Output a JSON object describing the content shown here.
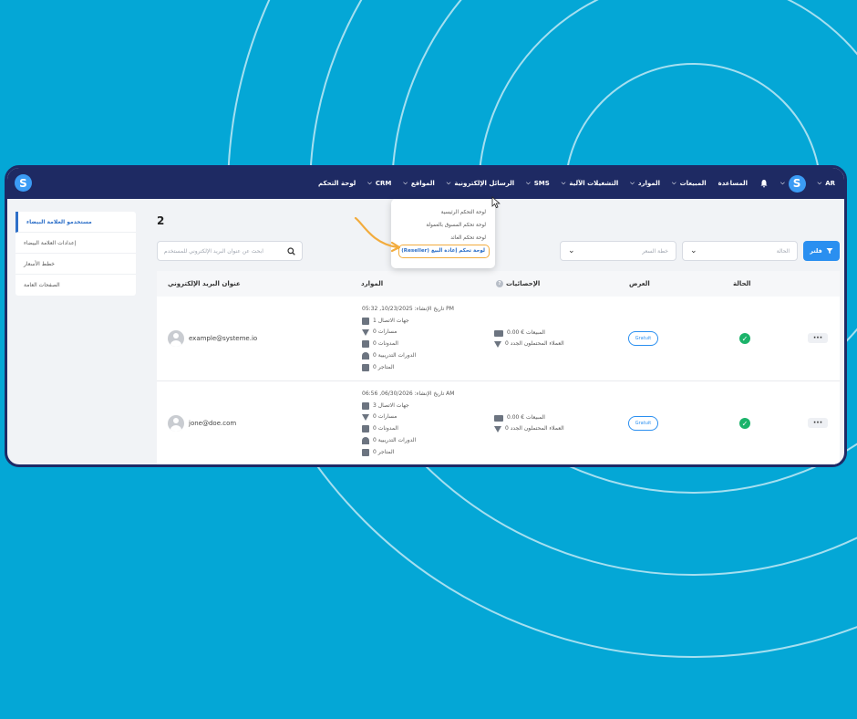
{
  "topbar": {
    "lang": "AR",
    "nav": [
      {
        "label": "لوحة التحكم",
        "caret": false
      },
      {
        "label": "CRM",
        "caret": true
      },
      {
        "label": "المواقع",
        "caret": true
      },
      {
        "label": "الرسائل الإلكترونية",
        "caret": true
      },
      {
        "label": "SMS",
        "caret": true
      },
      {
        "label": "التشغيلات الآلية",
        "caret": true
      },
      {
        "label": "الموارد",
        "caret": true
      },
      {
        "label": "المبيعات",
        "caret": true
      },
      {
        "label": "المساعدة",
        "caret": false
      }
    ],
    "avatar_letter": "S",
    "logo_letter": "S"
  },
  "sidebar": {
    "items": [
      {
        "label": "مستخدمو العلامة البيضاء",
        "active": true
      },
      {
        "label": "إعدادات العلامة البيضاء",
        "active": false
      },
      {
        "label": "خطط الأسعار",
        "active": false
      },
      {
        "label": "الصفحات العامة",
        "active": false
      }
    ]
  },
  "main": {
    "count": "2",
    "search_placeholder": "ابحث عن عنوان البريد الإلكتروني للمستخدم",
    "price_plan_placeholder": "خطة السعر",
    "status_placeholder": "الحالة",
    "filter_label": "فلتر"
  },
  "table": {
    "headers": {
      "email": "عنوان البريد الإلكتروني",
      "resources": "الموارد",
      "stats": "الإحصائيات",
      "offer": "العرض",
      "status": "الحالة"
    },
    "rows": [
      {
        "email": "example@systeme.io",
        "created": "تاريخ الإنشاء: 10/23/2025, 05:32 PM",
        "contacts": "جهات الاتصال 1",
        "funnels": "مسارات 0",
        "blogs": "المدونات 0",
        "courses": "الدورات التدريبية 0",
        "stores": "المتاجر 0",
        "sales": "المبيعات € 0.00",
        "leads": "العملاء المحتملون الجدد 0",
        "offer": "Gratuit"
      },
      {
        "email": "jone@doe.com",
        "created": "تاريخ الإنشاء: 06/30/2026, 06:56 AM",
        "contacts": "جهات الاتصال 3",
        "funnels": "مسارات 0",
        "blogs": "المدونات 0",
        "courses": "الدورات التدريبية 0",
        "stores": "المتاجر 0",
        "sales": "المبيعات € 0.00",
        "leads": "العملاء المحتملون الجدد 0",
        "offer": "Gratuit"
      }
    ]
  },
  "dropdown": {
    "items": [
      {
        "label": "لوحة التحكم الرئيسية",
        "highlight": false
      },
      {
        "label": "لوحة تحكم المسوق بالعمولة",
        "highlight": false
      },
      {
        "label": "لوحة تحكم العائد",
        "highlight": false
      },
      {
        "label": "(Reseller) لوحة تحكم إعادة البيع",
        "highlight": true
      }
    ]
  },
  "colors": {
    "background": "#04a7d6",
    "topbar": "#1e2a63",
    "accent": "#2a8ff0",
    "highlight": "#f2ac3e",
    "status_ok": "#1bb36a"
  },
  "icons": {
    "bell": "bell-icon",
    "search": "search-icon",
    "filter": "filter-icon",
    "status": "check-circle-icon"
  }
}
